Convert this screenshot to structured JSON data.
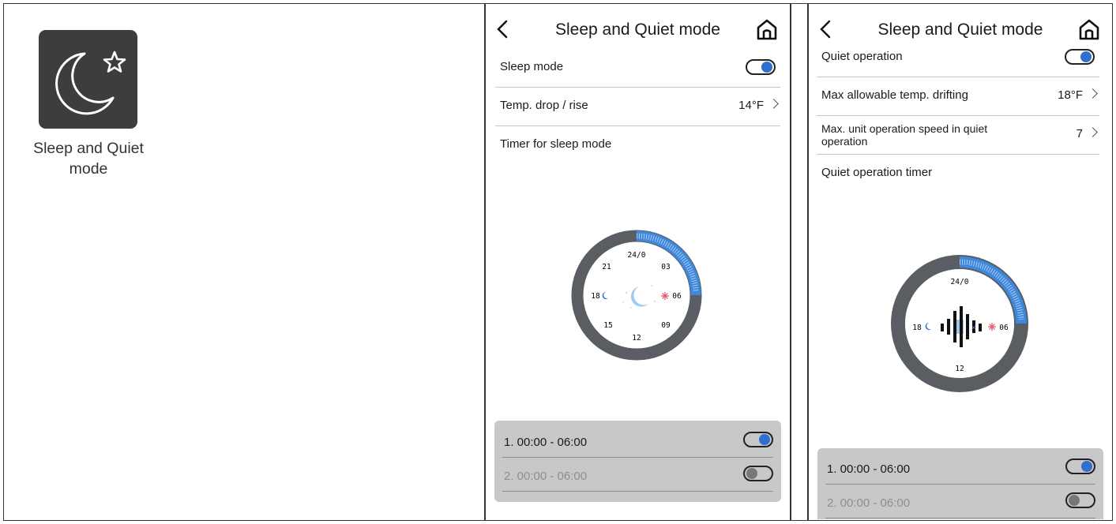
{
  "feature_tile": {
    "icon": "moon-star-icon",
    "caption_line1": "Sleep and Quiet",
    "caption_line2": "mode"
  },
  "sleep_screen": {
    "title": "Sleep and Quiet mode",
    "sleep_mode_label": "Sleep mode",
    "sleep_mode_on": true,
    "temp_drop_label": "Temp. drop / rise",
    "temp_drop_value": "14°F",
    "timer_label": "Timer for sleep mode",
    "dial_labels": [
      "24/0",
      "03",
      "06",
      "09",
      "12",
      "15",
      "18",
      "21"
    ],
    "dial_selected_fraction": 0.25,
    "timers": [
      {
        "label": "1. 00:00 - 06:00",
        "on": true
      },
      {
        "label": "2. 00:00 - 06:00",
        "on": false
      }
    ]
  },
  "quiet_screen": {
    "title": "Sleep and Quiet mode",
    "quiet_label": "Quiet operation",
    "quiet_on": true,
    "drift_label": "Max allowable temp. drifting",
    "drift_value": "18°F",
    "speed_label_line1": "Max. unit operation speed in quiet",
    "speed_label_line2": "operation",
    "speed_value": "7",
    "timer_label": "Quiet operation timer",
    "dial_labels": [
      "24/0",
      "06",
      "12",
      "18"
    ],
    "dial_selected_fraction": 0.25,
    "timers": [
      {
        "label": "1. 00:00 - 06:00",
        "on": true
      },
      {
        "label": "2. 00:00 - 06:00",
        "on": false
      }
    ]
  },
  "colors": {
    "accent": "#2f6fcf",
    "dial_ring": "#5a5d62",
    "dial_arc": "#3f87db",
    "timer_panel": "#c8c8c8"
  }
}
